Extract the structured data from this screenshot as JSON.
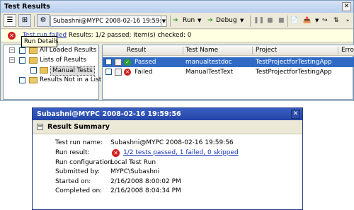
{
  "window": {
    "title": "Test Results",
    "close_glyph": "✕"
  },
  "toolbar": {
    "run_combo_value": "Subashni@MYPC 2008-02-16 19:59:5",
    "run_label": "Run",
    "debug_label": "Debug",
    "tooltip": "Run Details"
  },
  "status": {
    "link_text": "Test run failed",
    "rest": " Results: 1/2 passed;  Item(s) checked: 0"
  },
  "tree": {
    "items": [
      {
        "label": "All Loaded Results"
      },
      {
        "label": "Lists of Results"
      },
      {
        "label": "Manual Tests"
      },
      {
        "label": "Results Not in a List"
      }
    ]
  },
  "grid": {
    "columns": [
      "Result",
      "Test Name",
      "Project",
      "Erro"
    ],
    "rows": [
      {
        "result": "Passed",
        "test_name": "manualtestdoc",
        "project": "TestProjectforTestingApp"
      },
      {
        "result": "Failed",
        "test_name": "ManualTestText",
        "project": "TestProjectforTestingApp"
      }
    ]
  },
  "details": {
    "title": "Subashni@MYPC 2008-02-16 19:59:56",
    "close_glyph": "✕",
    "section": "Result Summary",
    "collapse_glyph": "−",
    "fields": [
      {
        "label": "Test run name:",
        "value": "Subashni@MYPC 2008-02-16 19:59:56"
      },
      {
        "label": "Run result:",
        "value": "1/2 tests passed, 1 failed, 0 skipped"
      },
      {
        "label": "Run configuration:",
        "value": "Local Test Run"
      },
      {
        "label": "Submitted by:",
        "value": "MYPC\\Subashni"
      },
      {
        "label": "Started on:",
        "value": "2/16/2008 8:00:02 PM"
      },
      {
        "label": "Completed on:",
        "value": "2/16/2008 8:04:34 PM"
      }
    ]
  },
  "colors": {
    "selection": "#316ac5",
    "error": "#d21f1f",
    "success": "#2c9e2c",
    "link": "#1a35b5",
    "details_title": "#2345a7"
  },
  "icons": {
    "error": "error-icon",
    "pass": "pass-icon",
    "fail": "fail-icon",
    "run": "run-icon",
    "debug": "debug-icon"
  }
}
